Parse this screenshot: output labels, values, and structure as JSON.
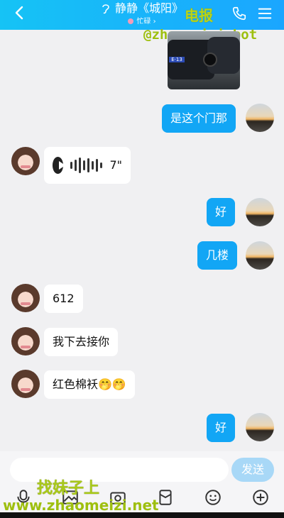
{
  "header": {
    "title": "静静《城阳》",
    "status": "忙碌",
    "status_chevron": "›",
    "watermark_top": "电报",
    "watermark_handle": "@zhaomeizi_bot"
  },
  "messages": {
    "m1": "是这个门那",
    "voice_duration": "7\"",
    "m2": "好",
    "m3": "几楼",
    "m4": "612",
    "m5": "我下去接你",
    "m6": "红色棉袄🤭🤭",
    "m7": "好"
  },
  "photo": {
    "plate_text": "E·13"
  },
  "input": {
    "placeholder": "",
    "send_label": "发送"
  },
  "watermark_bottom": {
    "cn": "找妹子上",
    "url": "www.zhaomeizi.net"
  },
  "colors": {
    "header": "#16c3f5",
    "bubble_right": "#12a6f5",
    "send_button": "#a8d8f7",
    "watermark": "#a9c91a"
  },
  "icons": [
    "back-arrow-icon",
    "ear-icon",
    "phone-icon",
    "menu-icon",
    "play-icon",
    "mic-icon",
    "image-icon",
    "red-packet-icon",
    "emoji-icon",
    "plus-icon"
  ]
}
